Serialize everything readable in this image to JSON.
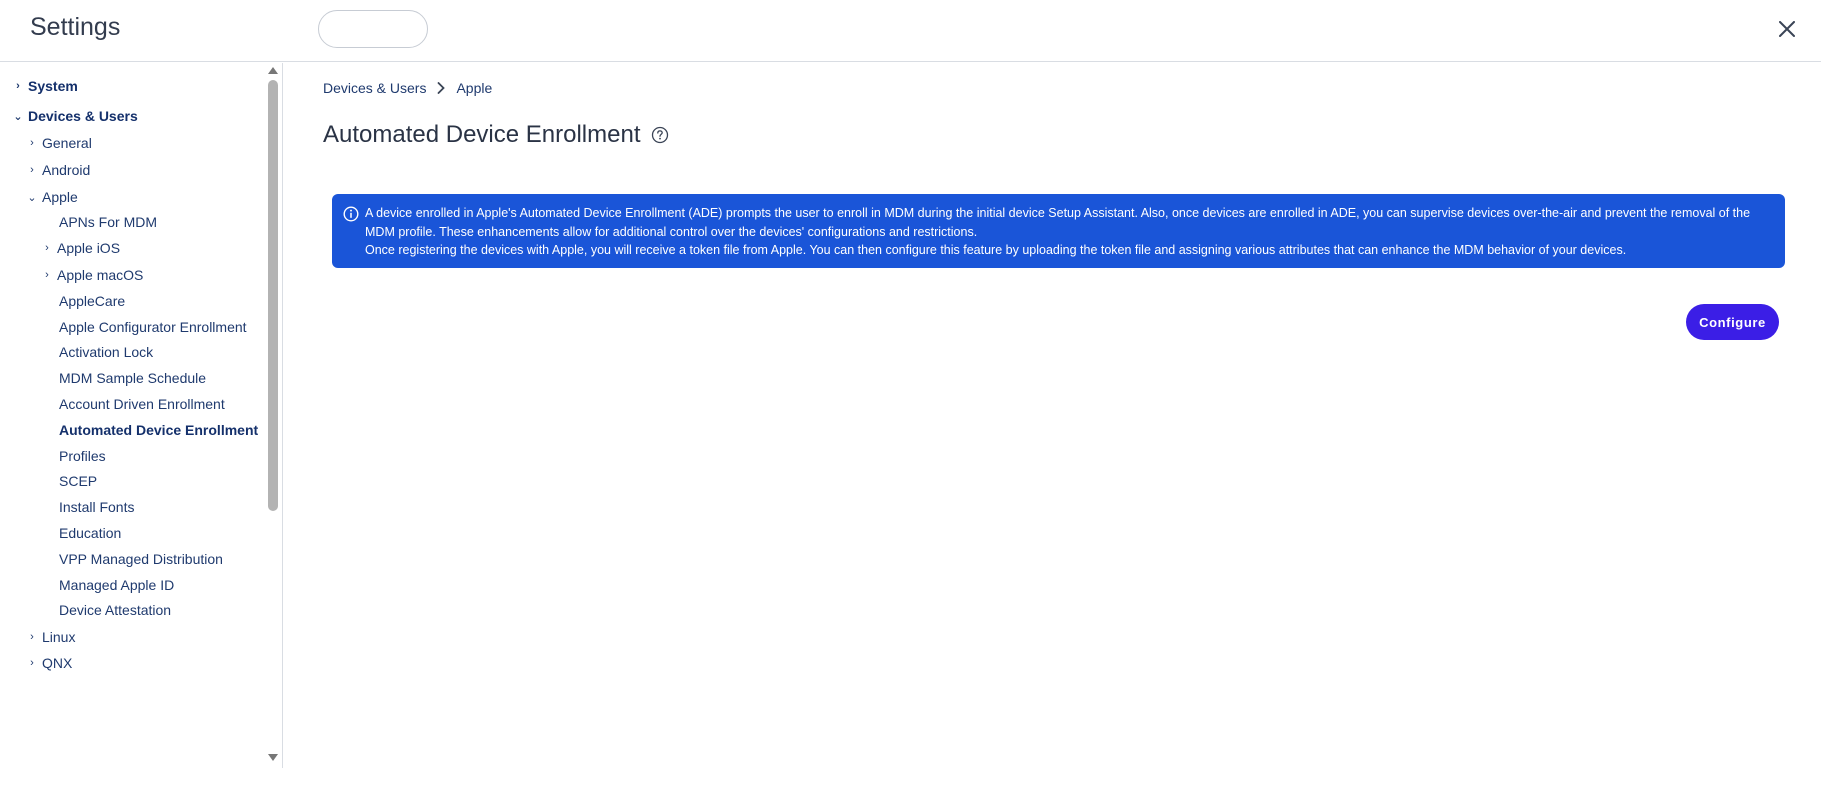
{
  "header": {
    "title": "Settings",
    "close_icon": "close-icon"
  },
  "sidebar": {
    "items": [
      {
        "label": "System",
        "level": 0,
        "chevron": "›"
      },
      {
        "label": "Devices & Users",
        "level": 0,
        "chevron": "⌄"
      },
      {
        "label": "General",
        "level": 1,
        "chevron": "›"
      },
      {
        "label": "Android",
        "level": 1,
        "chevron": "›"
      },
      {
        "label": "Apple",
        "level": 1,
        "chevron": "⌄"
      },
      {
        "label": "APNs For MDM",
        "level": 2,
        "chevron": ""
      },
      {
        "label": "Apple iOS",
        "level": 2,
        "chevron": "›"
      },
      {
        "label": "Apple macOS",
        "level": 2,
        "chevron": "›"
      },
      {
        "label": "AppleCare",
        "level": 2,
        "chevron": ""
      },
      {
        "label": "Apple Configurator Enrollment",
        "level": 2,
        "chevron": ""
      },
      {
        "label": "Activation Lock",
        "level": 2,
        "chevron": ""
      },
      {
        "label": "MDM Sample Schedule",
        "level": 2,
        "chevron": ""
      },
      {
        "label": "Account Driven Enrollment",
        "level": 2,
        "chevron": ""
      },
      {
        "label": "Automated Device Enrollment",
        "level": 2,
        "chevron": "",
        "active": true
      },
      {
        "label": "Profiles",
        "level": 2,
        "chevron": ""
      },
      {
        "label": "SCEP",
        "level": 2,
        "chevron": ""
      },
      {
        "label": "Install Fonts",
        "level": 2,
        "chevron": ""
      },
      {
        "label": "Education",
        "level": 2,
        "chevron": ""
      },
      {
        "label": "VPP Managed Distribution",
        "level": 2,
        "chevron": ""
      },
      {
        "label": "Managed Apple ID",
        "level": 2,
        "chevron": ""
      },
      {
        "label": "Device Attestation",
        "level": 2,
        "chevron": ""
      },
      {
        "label": "Linux",
        "level": 1,
        "chevron": "›"
      },
      {
        "label": "QNX",
        "level": 1,
        "chevron": "›"
      }
    ]
  },
  "breadcrumb": {
    "items": [
      "Devices & Users",
      "Apple"
    ]
  },
  "page": {
    "title": "Automated Device Enrollment",
    "help_icon": "help-icon"
  },
  "info_banner": {
    "line1": "A device enrolled in Apple's Automated Device Enrollment (ADE) prompts the user to enroll in MDM during the initial device Setup Assistant. Also, once devices are enrolled in ADE, you can supervise devices over-the-air and prevent the removal of the MDM profile. These enhancements allow for additional control over the devices' configurations and restrictions.",
    "line2": "Once registering the devices with Apple, you will receive a token file from Apple. You can then configure this feature by uploading the token file and assigning various attributes that can enhance the MDM behavior of your devices."
  },
  "actions": {
    "configure_label": "Configure"
  },
  "colors": {
    "banner": "#1a55d8",
    "primary_button": "#3b1ee6",
    "nav_text": "#1f3a6e"
  }
}
